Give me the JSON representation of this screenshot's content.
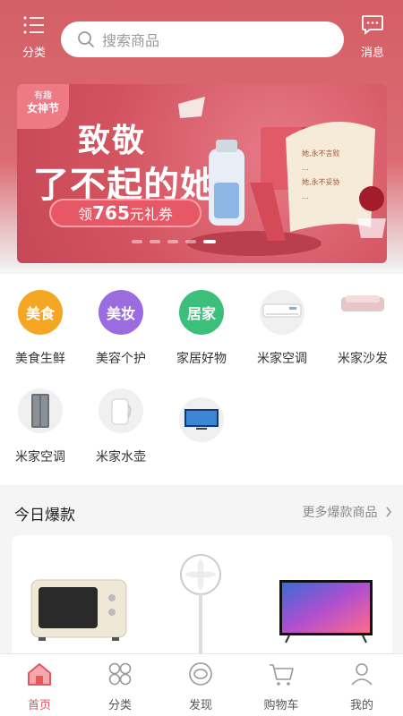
{
  "header": {
    "menu_label": "分类",
    "search_placeholder": "搜索商品",
    "message_label": "消息"
  },
  "banner": {
    "badge_top": "有趣",
    "badge_main": "女神节",
    "line1": "致敬",
    "line2": "了不起的她",
    "coupon_prefix": "领",
    "coupon_amount": "765",
    "coupon_suffix": "元礼券",
    "note_lines": [
      "她,永不言败",
      "...",
      "她,永不妥协",
      "..."
    ],
    "slide_count": 5,
    "active_slide": 5
  },
  "categories": [
    {
      "name": "美食生鲜",
      "icon_text": "美食",
      "icon": "food-icon",
      "color": "#f5a623"
    },
    {
      "name": "美容个护",
      "icon_text": "美妆",
      "icon": "beauty-icon",
      "color": "#9b6be0"
    },
    {
      "name": "家居好物",
      "icon_text": "居家",
      "icon": "home-icon",
      "color": "#3cbf7a"
    },
    {
      "name": "米家空调",
      "icon_text": "",
      "icon": "air-conditioner-icon",
      "color": "#f0f0f0"
    },
    {
      "name": "米家沙发",
      "icon_text": "",
      "icon": "sofa-icon",
      "color": "#f0f0f0"
    },
    {
      "name": "米家空调",
      "icon_text": "",
      "icon": "refrigerator-icon",
      "color": "#f0f0f0"
    },
    {
      "name": "米家水壶",
      "icon_text": "",
      "icon": "kettle-icon",
      "color": "#f0f0f0"
    },
    {
      "name": "",
      "icon_text": "",
      "icon": "tv-icon",
      "color": "#f0f0f0"
    }
  ],
  "hot": {
    "title": "今日爆款",
    "more": "更多爆款商品",
    "products": [
      {
        "icon": "microwave-oven-icon"
      },
      {
        "icon": "standing-fan-icon"
      },
      {
        "icon": "television-icon"
      }
    ]
  },
  "tabs": [
    {
      "label": "首页",
      "icon": "home-tab-icon",
      "active": true
    },
    {
      "label": "分类",
      "icon": "category-tab-icon",
      "active": false
    },
    {
      "label": "发现",
      "icon": "discover-tab-icon",
      "active": false
    },
    {
      "label": "购物车",
      "icon": "cart-tab-icon",
      "active": false
    },
    {
      "label": "我的",
      "icon": "profile-tab-icon",
      "active": false
    }
  ],
  "colors": {
    "accent": "#e5565e",
    "header": "#d45f66"
  }
}
